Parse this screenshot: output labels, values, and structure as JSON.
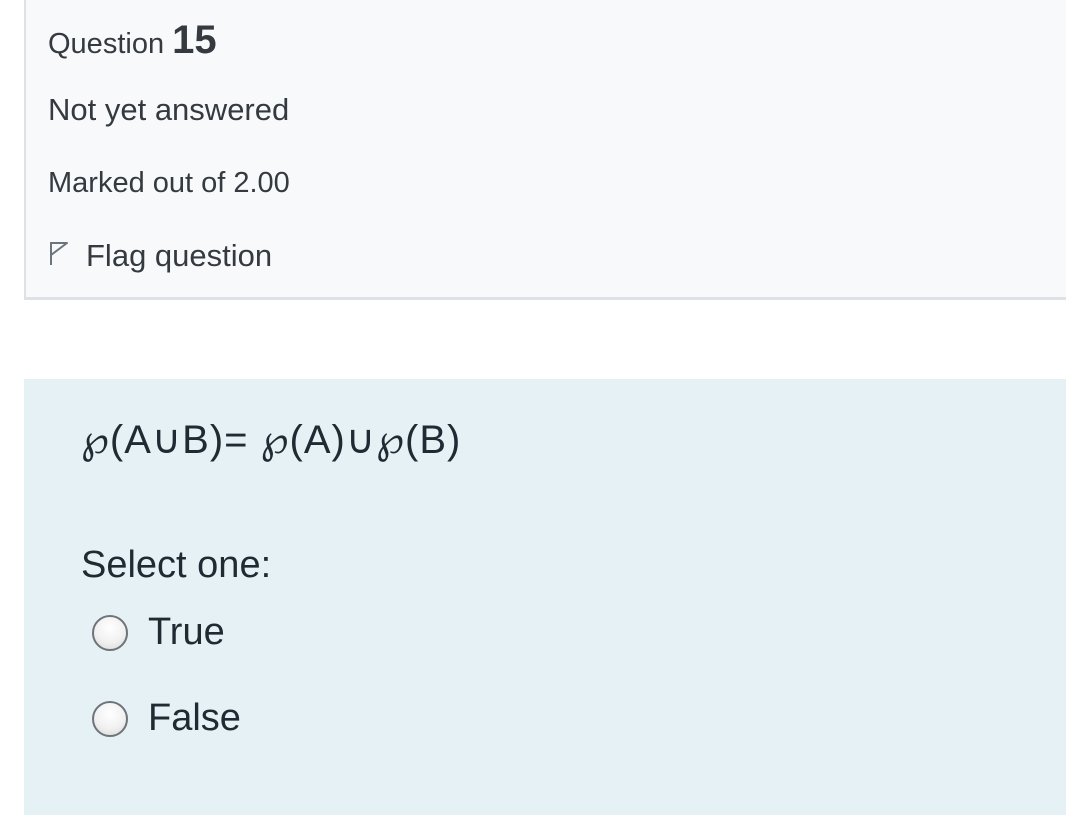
{
  "question": {
    "label": "Question",
    "number": "15",
    "state": "Not yet answered",
    "grade": "Marked out of 2.00",
    "flag_label": "Flag question"
  },
  "formulation": {
    "question_text": "℘(A∪B)= ℘(A)∪℘(B)",
    "prompt": "Select one:",
    "options": [
      {
        "label": "True",
        "selected": false
      },
      {
        "label": "False",
        "selected": false
      }
    ]
  },
  "icons": {
    "flag": "flag-outline-icon",
    "radio": "radio-button-unchecked"
  },
  "colors": {
    "info_background": "#f8f9fa",
    "formulation_background": "#e5f1f5",
    "text": "#343a40"
  }
}
